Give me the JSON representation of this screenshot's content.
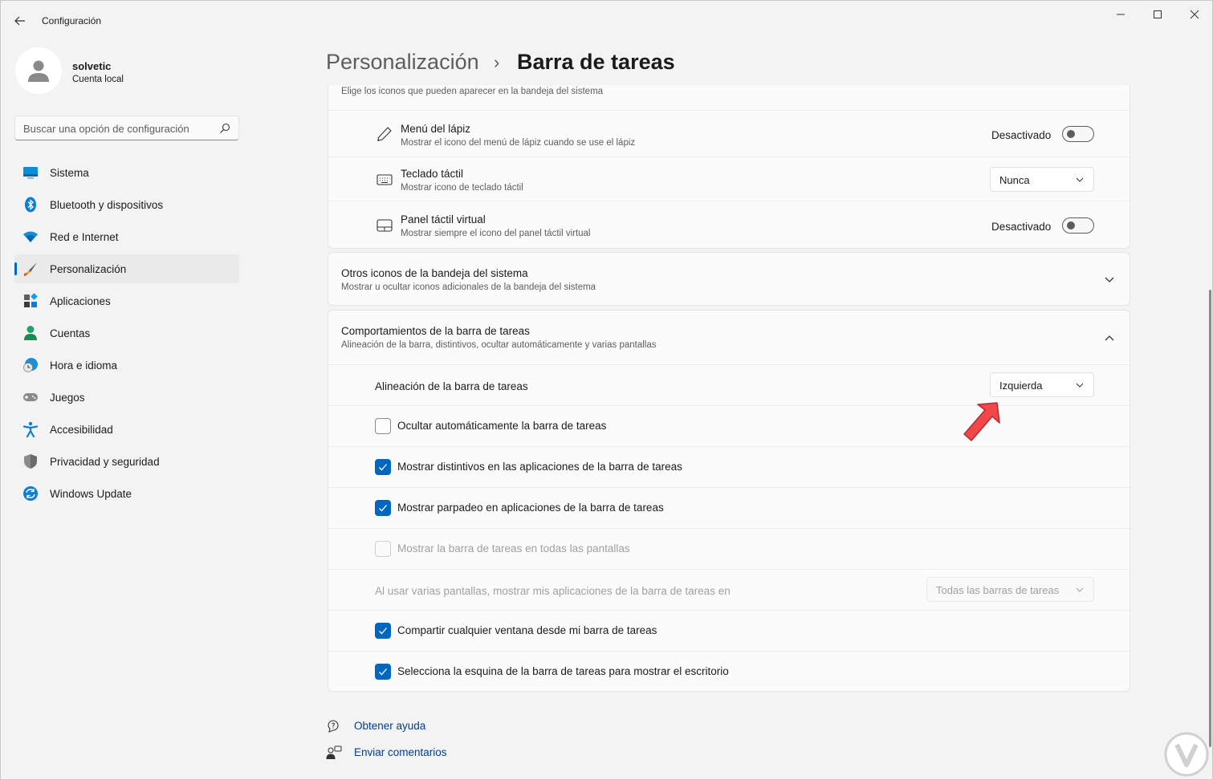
{
  "window": {
    "title": "Configuración"
  },
  "profile": {
    "name": "solvetic",
    "account_type": "Cuenta local"
  },
  "search": {
    "placeholder": "Buscar una opción de configuración"
  },
  "sidebar": {
    "items": [
      {
        "label": "Sistema",
        "icon": "monitor-icon"
      },
      {
        "label": "Bluetooth y dispositivos",
        "icon": "bluetooth-icon"
      },
      {
        "label": "Red e Internet",
        "icon": "wifi-icon"
      },
      {
        "label": "Personalización",
        "icon": "brush-icon",
        "active": true
      },
      {
        "label": "Aplicaciones",
        "icon": "apps-icon"
      },
      {
        "label": "Cuentas",
        "icon": "person-icon"
      },
      {
        "label": "Hora e idioma",
        "icon": "clock-globe-icon"
      },
      {
        "label": "Juegos",
        "icon": "gamepad-icon"
      },
      {
        "label": "Accesibilidad",
        "icon": "accessibility-icon"
      },
      {
        "label": "Privacidad y seguridad",
        "icon": "shield-icon"
      },
      {
        "label": "Windows Update",
        "icon": "update-icon"
      }
    ]
  },
  "header": {
    "parent": "Personalización",
    "separator": "›",
    "current": "Barra de tareas"
  },
  "tray_icons": {
    "description": "Elige los iconos que pueden aparecer en la bandeja del sistema",
    "pen_menu": {
      "title": "Menú del lápiz",
      "subtitle": "Mostrar el icono del menú de lápiz cuando se use el lápiz",
      "state_label": "Desactivado",
      "on": false
    },
    "touch_keyboard": {
      "title": "Teclado táctil",
      "subtitle": "Mostrar icono de teclado táctil",
      "value": "Nunca"
    },
    "virtual_touchpad": {
      "title": "Panel táctil virtual",
      "subtitle": "Mostrar siempre el icono del panel táctil virtual",
      "state_label": "Desactivado",
      "on": false
    }
  },
  "other_tray": {
    "title": "Otros iconos de la bandeja del sistema",
    "subtitle": "Mostrar u ocultar iconos adicionales de la bandeja del sistema",
    "expanded": false
  },
  "behaviors": {
    "title": "Comportamientos de la barra de tareas",
    "subtitle": "Alineación de la barra, distintivos, ocultar automáticamente y varias pantallas",
    "expanded": true,
    "alignment": {
      "label": "Alineación de la barra de tareas",
      "value": "Izquierda"
    },
    "autohide": {
      "label": "Ocultar automáticamente la barra de tareas",
      "checked": false
    },
    "badges": {
      "label": "Mostrar distintivos en las aplicaciones de la barra de tareas",
      "checked": true
    },
    "flashing": {
      "label": "Mostrar parpadeo en aplicaciones de la barra de tareas",
      "checked": true
    },
    "all_displays": {
      "label": "Mostrar la barra de tareas en todas las pantallas",
      "checked": false,
      "disabled": true
    },
    "multi_display": {
      "label": "Al usar varias pantallas, mostrar mis aplicaciones de la barra de tareas en",
      "value": "Todas las barras de tareas",
      "disabled": true
    },
    "share_window": {
      "label": "Compartir cualquier ventana desde mi barra de tareas",
      "checked": true
    },
    "corner_desktop": {
      "label": "Selecciona la esquina de la barra de tareas para mostrar el escritorio",
      "checked": true
    }
  },
  "footer": {
    "help": "Obtener ayuda",
    "feedback": "Enviar comentarios"
  },
  "colors": {
    "accent": "#0067c0",
    "link": "#003e92",
    "arrow": "#f0474a"
  }
}
